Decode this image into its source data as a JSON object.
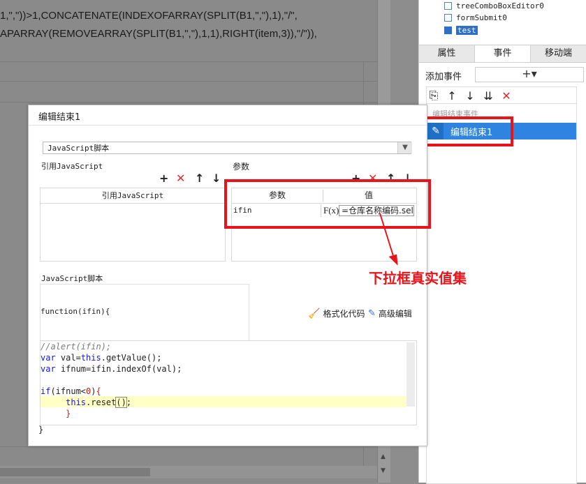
{
  "background": {
    "formula_line1": "1,\",\"))>1,CONCATENATE(INDEXOFARRAY(SPLIT(B1,\",\"),1),\"/\",",
    "formula_line2": "APARRAY(REMOVEARRAY(SPLIT(B1,\",\"),1,1),RIGHT(item,3)),\"/\")),"
  },
  "tree": {
    "items": [
      {
        "label": "treeComboBoxEditor0"
      },
      {
        "label": "formSubmit0"
      },
      {
        "label": "test"
      }
    ]
  },
  "panel": {
    "tabs": [
      {
        "label": "属性"
      },
      {
        "label": "事件"
      },
      {
        "label": "移动端"
      }
    ],
    "active_tab": "事件",
    "add_event_label": "添加事件",
    "add_event_button": "+▾",
    "event_group_label": "编辑结束事件",
    "event_item_label": "编辑结束1"
  },
  "dialog": {
    "title": "编辑结束1",
    "script_type": "JavaScript脚本",
    "ref_js_label": "引用JavaScript",
    "ref_js_header": "引用JavaScript",
    "params_label": "参数",
    "params_header_name": "参数",
    "params_header_value": "值",
    "param_row_name": "ifin",
    "param_row_fx": "F(x)",
    "param_row_value": "=仓库名称编码.sel",
    "script_label": "JavaScript脚本",
    "function_signature": "function(ifin){",
    "format_button": "格式化代码",
    "advanced_button": "高级编辑",
    "closing_brace": "}"
  },
  "annotation": {
    "text": "下拉框真实值集"
  },
  "colors": {
    "highlight_red": "#e8141b",
    "event_selected": "#2e84e0",
    "keyword_blue": "#1515d8"
  }
}
